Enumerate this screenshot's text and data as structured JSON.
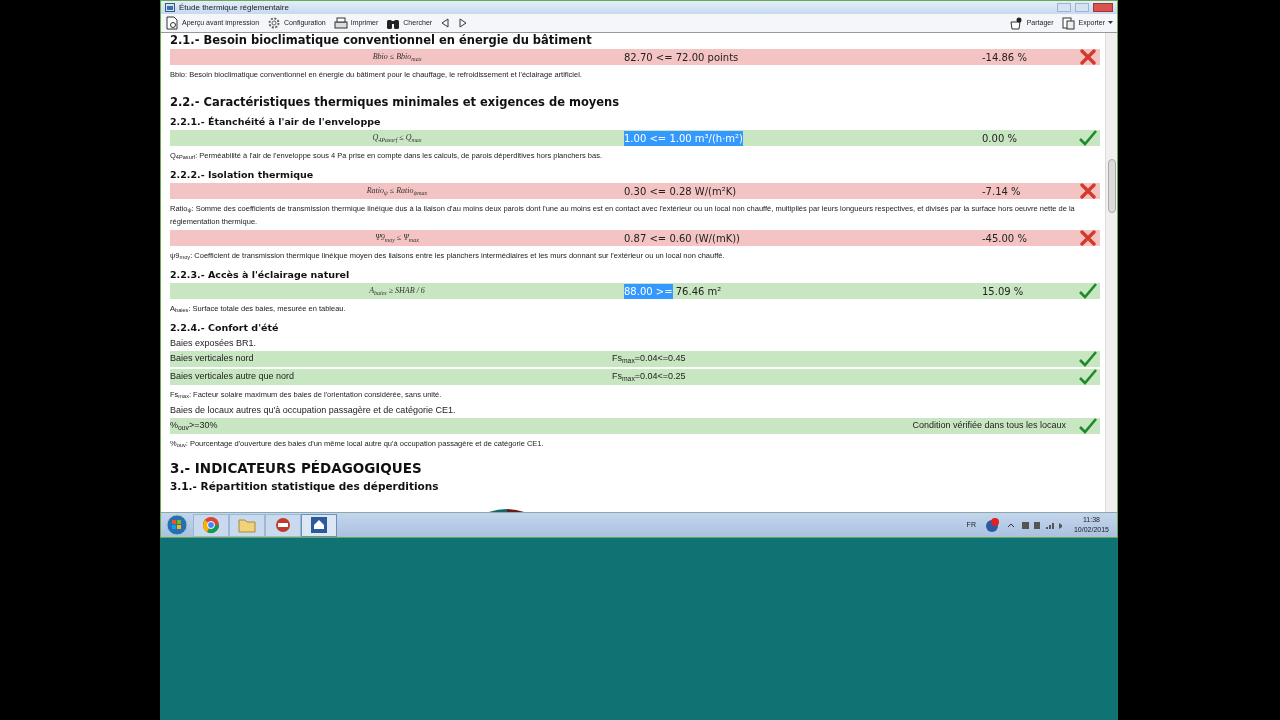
{
  "window": {
    "title": "Étude thermique réglementaire"
  },
  "toolbar": {
    "left": [
      {
        "label": "Aperçu avant impression"
      },
      {
        "label": "Configuration"
      },
      {
        "label": "Imprimer"
      },
      {
        "label": "Chercher"
      }
    ],
    "right": [
      {
        "label": "Partager"
      },
      {
        "label": "Exporter"
      }
    ]
  },
  "content": [
    {
      "kind": "heading2",
      "text": "2.1.- Besoin bioclimatique conventionnel en énergie du bâtiment"
    },
    {
      "kind": "check",
      "formula": "Bbio ≤ Bbio$_{max}$",
      "value": [
        {
          "text": "82.70 <= 72.00 points",
          "selected": false
        }
      ],
      "percent": "-14.86 %",
      "passed": false
    },
    {
      "kind": "note",
      "text": "Bbio: Besoin bioclimatique conventionnel en énergie du bâtiment pour le chauffage, le refroidissement et l'éclairage artificiel."
    },
    {
      "kind": "heading2",
      "text": "2.2.- Caractéristiques thermiques minimales et exigences de moyens"
    },
    {
      "kind": "heading3",
      "text": "2.2.1.- Étanchéité à l'air de l'enveloppe"
    },
    {
      "kind": "check",
      "formula": "Q$_{4Pasurf}$ ≤ Q$_{max}$",
      "value": [
        {
          "text": "1.00 <= 1.00 m³/(h·m²)",
          "selected": true
        }
      ],
      "percent": "0.00 %",
      "passed": true
    },
    {
      "kind": "note",
      "text": "Q$_{4Pasurf}$: Perméabilité à l'air de l'enveloppe sous 4 Pa prise en compte dans les calculs, de parois déperditives hors planchers bas."
    },
    {
      "kind": "heading3",
      "text": "2.2.2.- Isolation thermique"
    },
    {
      "kind": "check",
      "formula": "Ratio$_{ψ}$ ≤ Ratio$_{ψmax}$",
      "value": [
        {
          "text": "0.30 <= 0.28 W/(m²K)",
          "selected": false
        }
      ],
      "percent": "-7.14 %",
      "passed": false
    },
    {
      "kind": "note",
      "text": "Ratio$_{ψ}$: Somme des coefficients de transmission thermique linéique dus à la liaison d'au moins deux parois dont l'une au moins est en contact avec l'extérieur ou un local non chauffé, multipliés par leurs longueurs respectives, et divisés par la surface hors oeuvre nette de la réglementation thermique."
    },
    {
      "kind": "check",
      "formula": "Ψ9$_{moy}$ ≤ Ψ$_{max}$",
      "value": [
        {
          "text": "0.87 <= 0.60 (W/(mK))",
          "selected": false
        }
      ],
      "percent": "-45.00 %",
      "passed": false
    },
    {
      "kind": "note",
      "text": "ψ9$_{moy}$: Coefficient de transmission thermique linéique moyen des liaisons entre les planchers intermédiaires et les murs donnant sur l'extérieur ou un local non chauffé."
    },
    {
      "kind": "heading3",
      "text": "2.2.3.- Accès à l'éclairage naturel"
    },
    {
      "kind": "check",
      "formula": "A$_{baies}$ ≥ SHAB / 6",
      "value": [
        {
          "text": "88.00 >=",
          "selected": true
        },
        {
          "text": " 76.46 m²",
          "selected": false
        }
      ],
      "percent": "15.09 %",
      "passed": true
    },
    {
      "kind": "note",
      "text": "A$_{baies}$: Surface totale des baies, mesurée en tableau."
    },
    {
      "kind": "heading3",
      "text": "2.2.4.- Confort d'été"
    },
    {
      "kind": "text",
      "text": "Baies exposées BR1."
    },
    {
      "kind": "comfort",
      "label": "Baies verticales nord",
      "value": "Fs$_{max}$=0.04<=0.45",
      "passed": true
    },
    {
      "kind": "comfort",
      "label": "Baies verticales autre que nord",
      "value": "Fs$_{max}$=0.04<=0.25",
      "passed": true
    },
    {
      "kind": "note",
      "text": "Fs$_{max}$: Facteur solaire maximum des baies de l'orientation considérée, sans unité."
    },
    {
      "kind": "text",
      "text": "Baies de locaux autres qu'à occupation passagère et de catégorie CE1."
    },
    {
      "kind": "comfort",
      "label": "%$_{ouv}$>=30%",
      "result": "Condition vérifiée dans tous les locaux",
      "passed": true
    },
    {
      "kind": "note",
      "text": "%$_{ouv}$: Pourcentage d'ouverture des baies d'un même local autre qu'à occupation passagère et de catégorie CE1."
    },
    {
      "kind": "heading1",
      "text": "3.- INDICATEURS PÉDAGOGIQUES"
    },
    {
      "kind": "heading2b",
      "text": "3.1.- Répartition statistique des déperditions"
    },
    {
      "kind": "pies"
    }
  ],
  "taskbar": {
    "language": "FR",
    "time": "11:38",
    "date": "10/02/2015"
  }
}
